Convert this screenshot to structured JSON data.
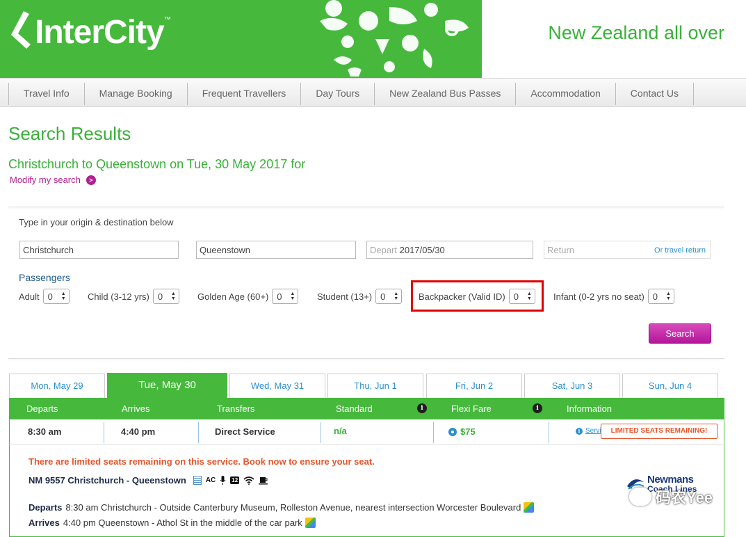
{
  "header": {
    "brand": "InterCity",
    "tagline": "New Zealand all over",
    "colors": {
      "green": "#46b93d",
      "magenta": "#b0208e",
      "link": "#2a8fcf",
      "alert": "#e8552a"
    }
  },
  "nav": {
    "items": [
      "Travel Info",
      "Manage Booking",
      "Frequent Travellers",
      "Day Tours",
      "New Zealand Bus Passes",
      "Accommodation",
      "Contact Us"
    ]
  },
  "page": {
    "title": "Search Results",
    "route": "Christchurch to Queenstown on Tue, 30 May 2017 for",
    "modify_link": "Modify my search",
    "modify_arrow": ">"
  },
  "search": {
    "instruction": "Type in your origin & destination below",
    "origin": "Christchurch",
    "destination": "Queenstown",
    "depart_label": "Depart",
    "depart_value": "2017/05/30",
    "return_label": "Return",
    "travel_return": "Or travel return",
    "passengers_label": "Passengers",
    "passengers": [
      {
        "label": "Adult",
        "value": "0"
      },
      {
        "label": "Child (3-12 yrs)",
        "value": "0"
      },
      {
        "label": "Golden Age (60+)",
        "value": "0"
      },
      {
        "label": "Student (13+)",
        "value": "0"
      },
      {
        "label": "Backpacker (Valid ID)",
        "value": "0"
      },
      {
        "label": "Infant (0-2 yrs no seat)",
        "value": "0"
      }
    ],
    "search_button": "Search"
  },
  "tabs": [
    "Mon, May 29",
    "Tue, May 30",
    "Wed, May 31",
    "Thu, Jun 1",
    "Fri, Jun 2",
    "Sat, Jun 3",
    "Sun, Jun 4"
  ],
  "results": {
    "columns": [
      "Departs",
      "Arrives",
      "Transfers",
      "Standard",
      "Flexi Fare",
      "Information"
    ],
    "info_glyph": "i",
    "row": {
      "departs": "8:30 am",
      "arrives": "4:40 pm",
      "transfers": "Direct Service",
      "standard": "n/a",
      "flexi": "$75",
      "service_info": "Service Info",
      "limited_badge": "LIMITED SEATS REMAINING!"
    },
    "limited_message": "There are limited seats remaining on this service. Book now to ensure your seat.",
    "service_name": "NM 9557  Christchurch - Queenstown",
    "amenity_ac": "AC",
    "amenity_usb": "12",
    "departs_label": "Departs",
    "departs_detail": "8:30 am Christchurch - Outside Canterbury Museum, Rolleston Avenue, nearest intersection Worcester Boulevard",
    "arrives_label": "Arrives",
    "arrives_detail": "4:40 pm Queenstown - Athol St in the middle of the car park",
    "operator": "Newmans",
    "operator_sub": "Coach Lines"
  },
  "watermark": "码农Yee"
}
